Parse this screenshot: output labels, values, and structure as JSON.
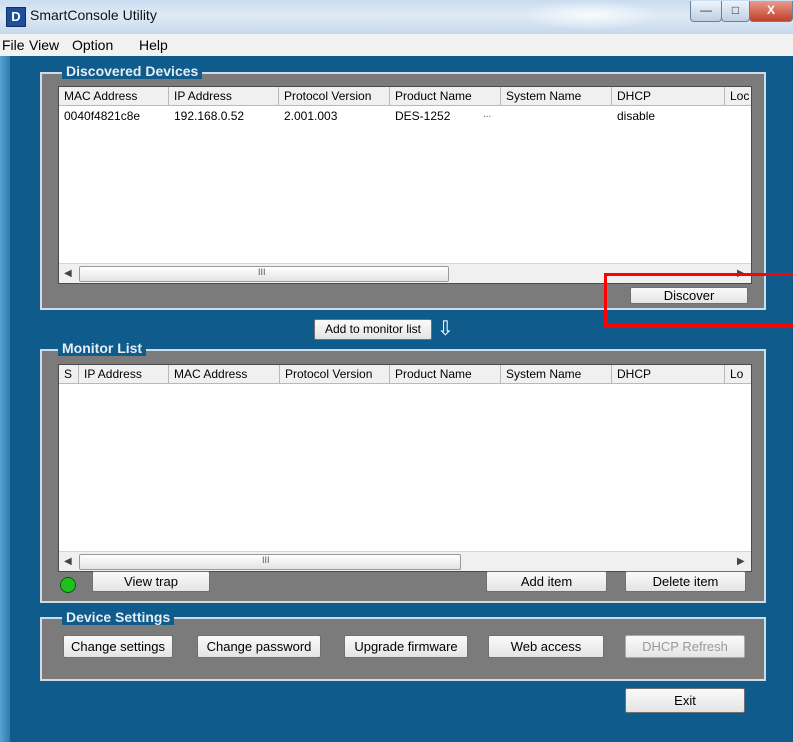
{
  "window": {
    "title": "SmartConsole Utility",
    "logo_letter": "D",
    "controls": {
      "minimize": "—",
      "maximize": "□",
      "close": "X"
    }
  },
  "menu": [
    "File",
    "View",
    "Option",
    "Help"
  ],
  "discovered": {
    "legend": "Discovered Devices",
    "columns": [
      "MAC Address",
      "IP Address",
      "Protocol Version",
      "Product Name",
      "System Name",
      "DHCP",
      "Loc"
    ],
    "rows": [
      {
        "mac": "0040f4821c8e",
        "ip": "192.168.0.52",
        "protocol": "2.001.003",
        "product": "DES-1252",
        "ellipsis": "...",
        "system": "",
        "dhcp": "disable",
        "loc": ""
      }
    ],
    "scroll_grip": "III",
    "discover_label": "Discover"
  },
  "add_to_monitor_label": "Add to monitor list",
  "add_arrow": "⇩",
  "monitor": {
    "legend": "Monitor List",
    "columns": [
      "S",
      "IP Address",
      "MAC Address",
      "Protocol Version",
      "Product Name",
      "System Name",
      "DHCP",
      "Lo"
    ],
    "scroll_grip": "III",
    "view_trap_label": "View trap",
    "add_item_label": "Add item",
    "delete_item_label": "Delete item",
    "status_color": "#20c020"
  },
  "device_settings": {
    "legend": "Device Settings",
    "buttons": {
      "change_settings": "Change settings",
      "change_password": "Change password",
      "upgrade_firmware": "Upgrade firmware",
      "web_access": "Web access",
      "dhcp_refresh": "DHCP Refresh"
    }
  },
  "exit_label": "Exit",
  "colors": {
    "app_bg": "#0f5c8c",
    "group_bg": "#7b7b7b",
    "highlight": "#ff0000"
  }
}
